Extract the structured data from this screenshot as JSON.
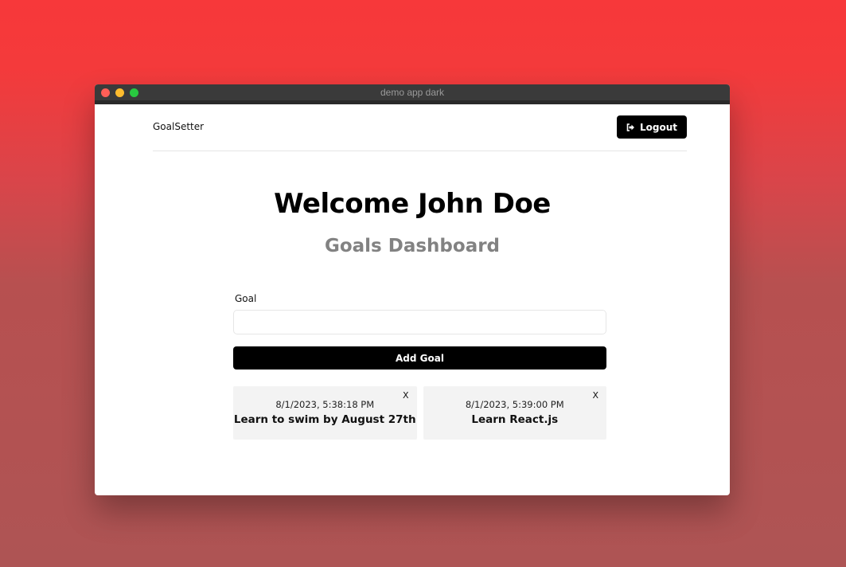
{
  "window": {
    "title": "demo app dark"
  },
  "header": {
    "brand": "GoalSetter",
    "logout_label": "Logout",
    "logout_icon": "sign-out-icon"
  },
  "main": {
    "heading": "Welcome John Doe",
    "subheading": "Goals Dashboard"
  },
  "form": {
    "goal_label": "Goal",
    "goal_value": "",
    "submit_label": "Add Goal"
  },
  "goals": [
    {
      "date": "8/1/2023, 5:38:18 PM",
      "text": "Learn to swim by August 27th",
      "delete_label": "X"
    },
    {
      "date": "8/1/2023, 5:39:00 PM",
      "text": "Learn React.js",
      "delete_label": "X"
    }
  ],
  "colors": {
    "background_top": "#f7383a",
    "background_bottom": "#ae5454",
    "button": "#000000",
    "card": "#f3f3f3",
    "subheading": "#828282"
  }
}
